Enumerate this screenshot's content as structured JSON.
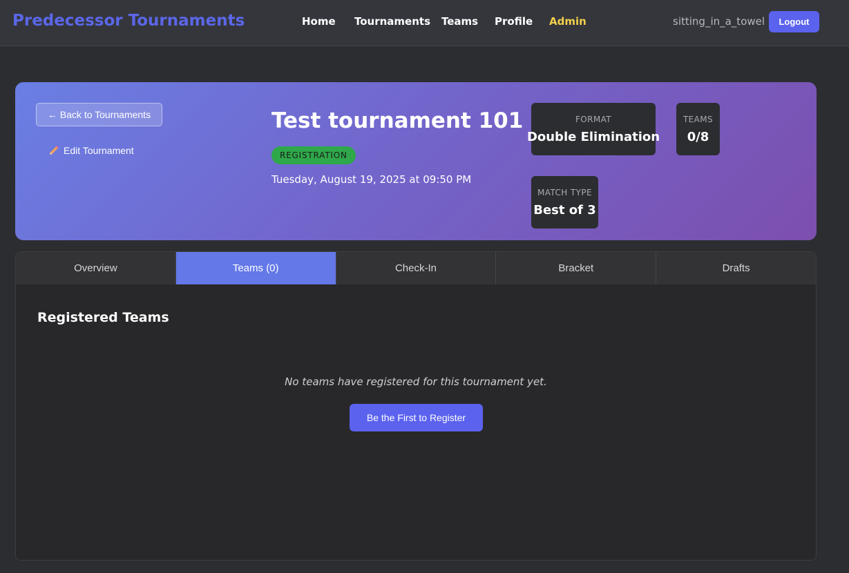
{
  "header": {
    "brand": "Predecessor Tournaments",
    "nav": [
      "Home",
      "Tournaments",
      "Teams",
      "Profile",
      "Admin"
    ],
    "username": "sitting_in_a_towel",
    "logout_label": "Logout"
  },
  "hero": {
    "back_label": "← Back to Tournaments",
    "edit_label": "Edit Tournament",
    "title": "Test tournament 101",
    "status": "REGISTRATION",
    "date": "Tuesday, August 19, 2025 at 09:50 PM",
    "stats": {
      "format": {
        "label": "FORMAT",
        "value": "Double Elimination"
      },
      "teams": {
        "label": "TEAMS",
        "value": "0/8"
      },
      "match_type": {
        "label": "MATCH TYPE",
        "value": "Best of 3"
      }
    }
  },
  "tabs": [
    "Overview",
    "Teams (0)",
    "Check-In",
    "Bracket",
    "Drafts"
  ],
  "active_tab": "Teams (0)",
  "teams_section": {
    "title": "Registered Teams",
    "empty_message": "No teams have registered for this tournament yet.",
    "register_label": "Be the First to Register"
  },
  "colors": {
    "brand": "#5b67e8",
    "admin": "#f2d04a",
    "accent_button": "#5b62ee",
    "active_tab": "#6478e8",
    "status_badge": "#2ea84a",
    "hero_gradient_start": "#6a7fe4",
    "hero_gradient_end": "#7c4fae"
  },
  "icons": {
    "edit": "pencil-icon"
  }
}
